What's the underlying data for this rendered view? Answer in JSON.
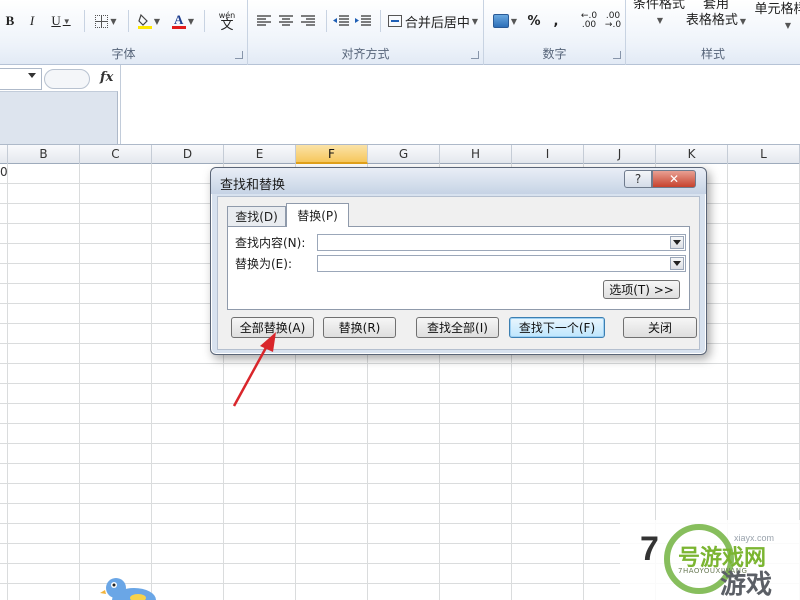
{
  "ribbon": {
    "font": {
      "bold": "B",
      "italic": "I",
      "underline": "U",
      "pinyin": "wén",
      "group_label": "字体"
    },
    "align": {
      "merge_label": "合并后居中",
      "group_label": "对齐方式"
    },
    "number": {
      "percent": "%",
      "comma": ",",
      "inc_decimal": ".00",
      "dec_decimal": ".00",
      "group_label": "数字"
    },
    "styles": {
      "cond_format": "条件格式",
      "table_format_1": "套用",
      "table_format_2": "表格格式",
      "cell_style": "单元格样式",
      "group_label": "样式"
    }
  },
  "formula_bar": {
    "fx_label": "fx"
  },
  "grid": {
    "columns": [
      "B",
      "C",
      "D",
      "E",
      "F",
      "G",
      "H",
      "I",
      "J",
      "K",
      "L"
    ],
    "selected_column": "F",
    "cell_a1_fragment": "0"
  },
  "dialog": {
    "title": "查找和替换",
    "help_glyph": "?",
    "close_glyph": "✕",
    "tabs": [
      {
        "label": "查找(D)"
      },
      {
        "label": "替换(P)"
      }
    ],
    "find_what_label": "查找内容(N):",
    "find_what_value": "",
    "replace_with_label": "替换为(E):",
    "replace_with_value": "",
    "options_label": "选项(T) >>",
    "buttons": {
      "replace_all": "全部替换(A)",
      "replace": "替换(R)",
      "find_all": "查找全部(I)",
      "find_next": "查找下一个(F)",
      "close": "关闭"
    }
  },
  "watermark": {
    "number": "7",
    "site": "xiayx.com",
    "name_1": "号游戏网",
    "name_en": "7HAOYOUXIWANG",
    "name_2": "游戏"
  },
  "colors": {
    "dialog_bg": "#d8e2ef",
    "arrow": "#d9262b",
    "selected_col": "#f6c75d",
    "watermark_green": "#5fa827"
  }
}
